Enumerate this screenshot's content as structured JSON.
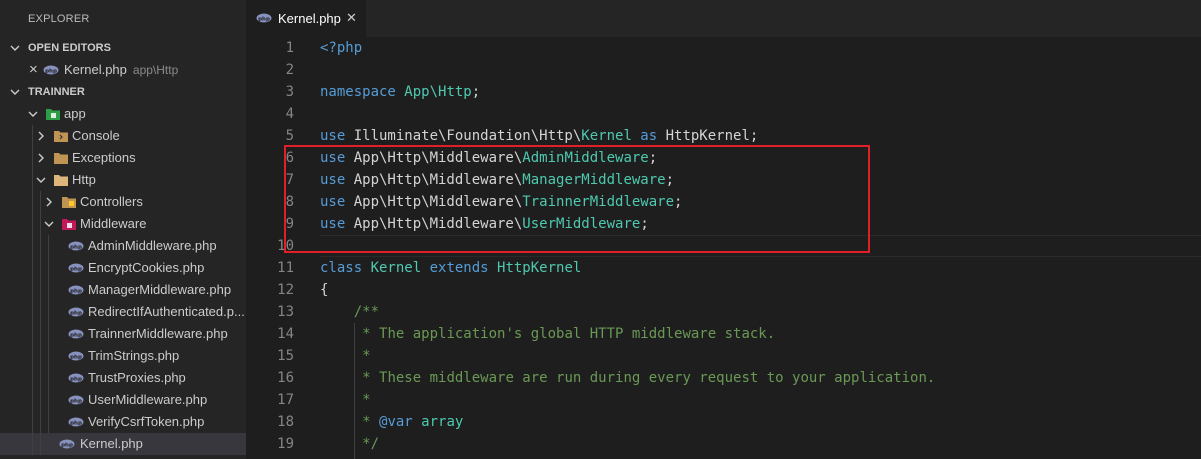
{
  "sidebar": {
    "title": "EXPLORER",
    "open_editors": {
      "header": "OPEN EDITORS",
      "item": {
        "close": "×",
        "name": "Kernel.php",
        "desc": "app\\Http"
      }
    },
    "project": {
      "header": "TRAINNER",
      "tree": [
        {
          "label": "app",
          "type": "folder-special",
          "depth": 0,
          "expanded": true
        },
        {
          "label": "Console",
          "type": "folder",
          "depth": 1,
          "expanded": false
        },
        {
          "label": "Exceptions",
          "type": "folder",
          "depth": 1,
          "expanded": false
        },
        {
          "label": "Http",
          "type": "folder",
          "depth": 1,
          "expanded": true
        },
        {
          "label": "Controllers",
          "type": "folder",
          "depth": 2,
          "expanded": false
        },
        {
          "label": "Middleware",
          "type": "folder-special",
          "depth": 2,
          "expanded": true
        },
        {
          "label": "AdminMiddleware.php",
          "type": "php",
          "depth": 3
        },
        {
          "label": "EncryptCookies.php",
          "type": "php",
          "depth": 3
        },
        {
          "label": "ManagerMiddleware.php",
          "type": "php",
          "depth": 3
        },
        {
          "label": "RedirectIfAuthenticated.p...",
          "type": "php",
          "depth": 3
        },
        {
          "label": "TrainnerMiddleware.php",
          "type": "php",
          "depth": 3
        },
        {
          "label": "TrimStrings.php",
          "type": "php",
          "depth": 3
        },
        {
          "label": "TrustProxies.php",
          "type": "php",
          "depth": 3
        },
        {
          "label": "UserMiddleware.php",
          "type": "php",
          "depth": 3
        },
        {
          "label": "VerifyCsrfToken.php",
          "type": "php",
          "depth": 3
        },
        {
          "label": "Kernel.php",
          "type": "php",
          "depth": 2,
          "selected": true
        }
      ]
    }
  },
  "tab": {
    "label": "Kernel.php",
    "close": "✕"
  },
  "code": [
    {
      "n": "1",
      "tokens": [
        [
          "kw",
          "<?php"
        ]
      ]
    },
    {
      "n": "2",
      "tokens": []
    },
    {
      "n": "3",
      "tokens": [
        [
          "kw",
          "namespace "
        ],
        [
          "cls",
          "App\\Http"
        ],
        [
          "pl",
          ";"
        ]
      ]
    },
    {
      "n": "4",
      "tokens": []
    },
    {
      "n": "5",
      "tokens": [
        [
          "kw",
          "use "
        ],
        [
          "pl",
          "Illuminate\\Foundation\\Http\\"
        ],
        [
          "cls",
          "Kernel"
        ],
        [
          "kw",
          " as "
        ],
        [
          "pl",
          "HttpKernel;"
        ]
      ]
    },
    {
      "n": "6",
      "tokens": [
        [
          "kw",
          "use "
        ],
        [
          "pl",
          "App\\Http\\Middleware\\"
        ],
        [
          "cls",
          "AdminMiddleware"
        ],
        [
          "pl",
          ";"
        ]
      ]
    },
    {
      "n": "7",
      "tokens": [
        [
          "kw",
          "use "
        ],
        [
          "pl",
          "App\\Http\\Middleware\\"
        ],
        [
          "cls",
          "ManagerMiddleware"
        ],
        [
          "pl",
          ";"
        ]
      ]
    },
    {
      "n": "8",
      "tokens": [
        [
          "kw",
          "use "
        ],
        [
          "pl",
          "App\\Http\\Middleware\\"
        ],
        [
          "cls",
          "TrainnerMiddleware"
        ],
        [
          "pl",
          ";"
        ]
      ]
    },
    {
      "n": "9",
      "tokens": [
        [
          "kw",
          "use "
        ],
        [
          "pl",
          "App\\Http\\Middleware\\"
        ],
        [
          "cls",
          "UserMiddleware"
        ],
        [
          "pl",
          ";"
        ]
      ]
    },
    {
      "n": "10",
      "tokens": []
    },
    {
      "n": "11",
      "tokens": [
        [
          "kw",
          "class "
        ],
        [
          "cls",
          "Kernel"
        ],
        [
          "kw",
          " extends "
        ],
        [
          "cls",
          "HttpKernel"
        ]
      ]
    },
    {
      "n": "12",
      "tokens": [
        [
          "pl",
          "{"
        ]
      ]
    },
    {
      "n": "13",
      "tokens": [
        [
          "pl",
          "    "
        ],
        [
          "cm",
          "/**"
        ]
      ]
    },
    {
      "n": "14",
      "tokens": [
        [
          "pl",
          "     "
        ],
        [
          "cm",
          "* The application's global HTTP middleware stack."
        ]
      ]
    },
    {
      "n": "15",
      "tokens": [
        [
          "pl",
          "     "
        ],
        [
          "cm",
          "*"
        ]
      ]
    },
    {
      "n": "16",
      "tokens": [
        [
          "pl",
          "     "
        ],
        [
          "cm",
          "* These middleware are run during every request to your application."
        ]
      ]
    },
    {
      "n": "17",
      "tokens": [
        [
          "pl",
          "     "
        ],
        [
          "cm",
          "*"
        ]
      ]
    },
    {
      "n": "18",
      "tokens": [
        [
          "pl",
          "     "
        ],
        [
          "cm",
          "* "
        ],
        [
          "kw",
          "@var"
        ],
        [
          "cls",
          " array"
        ]
      ]
    },
    {
      "n": "19",
      "tokens": [
        [
          "pl",
          "     "
        ],
        [
          "cm",
          "*/"
        ]
      ]
    }
  ],
  "colors": {
    "keyword": "#569cd6",
    "class": "#4ec9b0",
    "comment": "#6a9955",
    "highlight_box": "#e01f26"
  }
}
